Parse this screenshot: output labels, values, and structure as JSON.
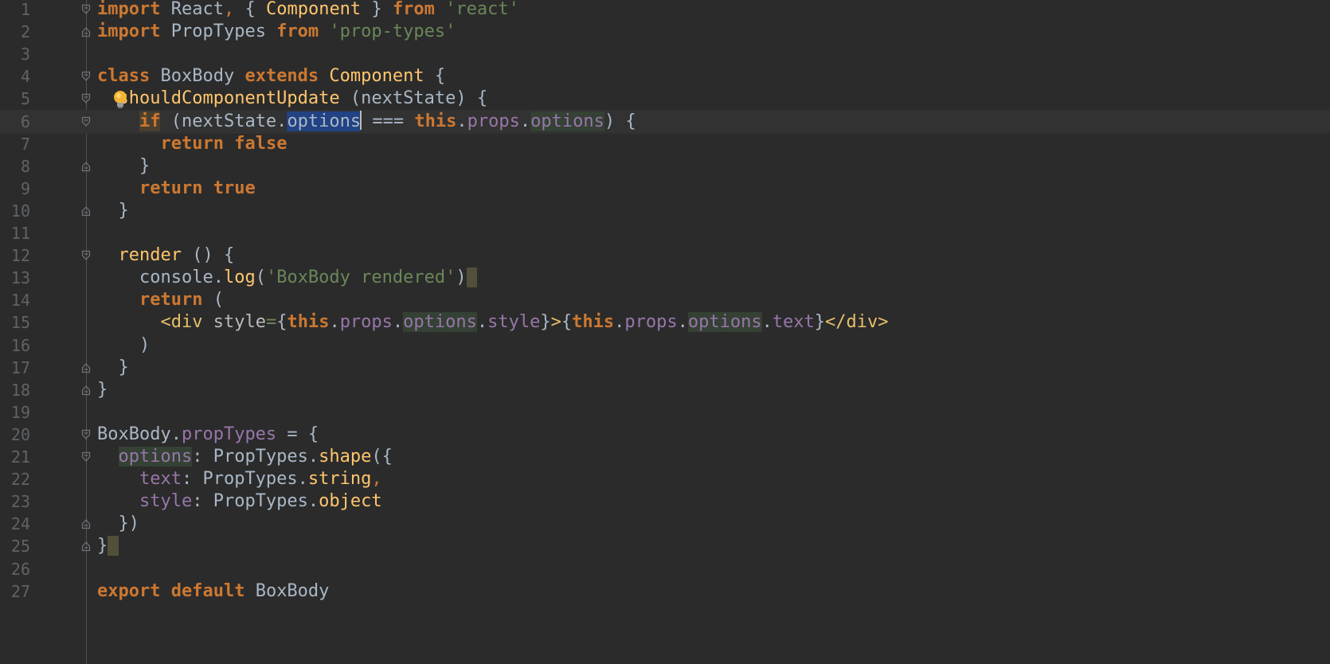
{
  "editor": {
    "language": "javascript",
    "current_line": 6,
    "lines": [
      {
        "n": "1",
        "fold": "open",
        "tokens": [
          {
            "t": "import",
            "k": "keyword"
          },
          {
            "t": " React",
            "k": "plain"
          },
          {
            "t": ",",
            "k": "punct"
          },
          {
            "t": " { ",
            "k": "plain"
          },
          {
            "t": "Component",
            "k": "class"
          },
          {
            "t": " } ",
            "k": "plain"
          },
          {
            "t": "from",
            "k": "keyword"
          },
          {
            "t": " ",
            "k": "plain"
          },
          {
            "t": "'react'",
            "k": "string"
          }
        ]
      },
      {
        "n": "2",
        "fold": "close",
        "tokens": [
          {
            "t": "import",
            "k": "keyword"
          },
          {
            "t": " PropTypes ",
            "k": "plain"
          },
          {
            "t": "from",
            "k": "keyword"
          },
          {
            "t": " ",
            "k": "plain"
          },
          {
            "t": "'prop-types'",
            "k": "string"
          }
        ]
      },
      {
        "n": "3",
        "fold": "",
        "tokens": []
      },
      {
        "n": "4",
        "fold": "open",
        "tokens": [
          {
            "t": "class",
            "k": "keyword"
          },
          {
            "t": " BoxBody ",
            "k": "plain"
          },
          {
            "t": "extends",
            "k": "keyword"
          },
          {
            "t": " ",
            "k": "plain"
          },
          {
            "t": "Component",
            "k": "class"
          },
          {
            "t": " {",
            "k": "plain"
          }
        ]
      },
      {
        "n": "5",
        "fold": "open",
        "bulb": true,
        "tokens": [
          {
            "t": "  ",
            "k": "plain"
          },
          {
            "t": "shouldComponentUpdate",
            "k": "method"
          },
          {
            "t": " (nextState) {",
            "k": "plain"
          }
        ]
      },
      {
        "n": "6",
        "fold": "open",
        "tokens": [
          {
            "t": "    ",
            "k": "plain"
          },
          {
            "t": "if",
            "k": "keyword",
            "hl": "keyword"
          },
          {
            "t": " (nextState.",
            "k": "plain"
          },
          {
            "t": "options",
            "k": "plain",
            "hl": "selection"
          },
          {
            "caret": true
          },
          {
            "t": " === ",
            "k": "plain"
          },
          {
            "t": "this",
            "k": "keyword"
          },
          {
            "t": ".",
            "k": "plain"
          },
          {
            "t": "props",
            "k": "field"
          },
          {
            "t": ".",
            "k": "plain"
          },
          {
            "t": "options",
            "k": "field",
            "hl": "usage"
          },
          {
            "t": ") {",
            "k": "plain"
          }
        ]
      },
      {
        "n": "7",
        "fold": "",
        "tokens": [
          {
            "t": "      ",
            "k": "plain"
          },
          {
            "t": "return",
            "k": "keyword"
          },
          {
            "t": " ",
            "k": "plain"
          },
          {
            "t": "false",
            "k": "keyword"
          }
        ]
      },
      {
        "n": "8",
        "fold": "close",
        "tokens": [
          {
            "t": "    }",
            "k": "plain"
          }
        ]
      },
      {
        "n": "9",
        "fold": "",
        "tokens": [
          {
            "t": "    ",
            "k": "plain"
          },
          {
            "t": "return",
            "k": "keyword"
          },
          {
            "t": " ",
            "k": "plain"
          },
          {
            "t": "true",
            "k": "keyword"
          }
        ]
      },
      {
        "n": "10",
        "fold": "close",
        "tokens": [
          {
            "t": "  }",
            "k": "plain"
          }
        ]
      },
      {
        "n": "11",
        "fold": "",
        "tokens": []
      },
      {
        "n": "12",
        "fold": "open",
        "tokens": [
          {
            "t": "  ",
            "k": "plain"
          },
          {
            "t": "render",
            "k": "method"
          },
          {
            "t": " () {",
            "k": "plain"
          }
        ]
      },
      {
        "n": "13",
        "fold": "",
        "tokens": [
          {
            "t": "    console.",
            "k": "plain"
          },
          {
            "t": "log",
            "k": "function"
          },
          {
            "t": "(",
            "k": "plain"
          },
          {
            "t": "'BoxBody rendered'",
            "k": "string"
          },
          {
            "t": ")",
            "k": "plain"
          },
          {
            "t": " ",
            "k": "plain",
            "hl": "caret-box"
          }
        ]
      },
      {
        "n": "14",
        "fold": "",
        "tokens": [
          {
            "t": "    ",
            "k": "plain"
          },
          {
            "t": "return",
            "k": "keyword"
          },
          {
            "t": " (",
            "k": "plain"
          }
        ]
      },
      {
        "n": "15",
        "fold": "",
        "tokens": [
          {
            "t": "      ",
            "k": "plain"
          },
          {
            "t": "<div",
            "k": "tag"
          },
          {
            "t": " ",
            "k": "plain"
          },
          {
            "t": "style",
            "k": "attr"
          },
          {
            "t": "=",
            "k": "string"
          },
          {
            "t": "{",
            "k": "plain"
          },
          {
            "t": "this",
            "k": "keyword"
          },
          {
            "t": ".",
            "k": "plain"
          },
          {
            "t": "props",
            "k": "field"
          },
          {
            "t": ".",
            "k": "plain"
          },
          {
            "t": "options",
            "k": "field",
            "hl": "usage"
          },
          {
            "t": ".",
            "k": "plain"
          },
          {
            "t": "style",
            "k": "field"
          },
          {
            "t": "}",
            "k": "plain"
          },
          {
            "t": ">",
            "k": "tag"
          },
          {
            "t": "{",
            "k": "plain"
          },
          {
            "t": "this",
            "k": "keyword"
          },
          {
            "t": ".",
            "k": "plain"
          },
          {
            "t": "props",
            "k": "field"
          },
          {
            "t": ".",
            "k": "plain"
          },
          {
            "t": "options",
            "k": "field",
            "hl": "usage"
          },
          {
            "t": ".",
            "k": "plain"
          },
          {
            "t": "text",
            "k": "field"
          },
          {
            "t": "}",
            "k": "plain"
          },
          {
            "t": "</div>",
            "k": "tag"
          }
        ]
      },
      {
        "n": "16",
        "fold": "",
        "tokens": [
          {
            "t": "    )",
            "k": "plain"
          }
        ]
      },
      {
        "n": "17",
        "fold": "close",
        "tokens": [
          {
            "t": "  }",
            "k": "plain"
          }
        ]
      },
      {
        "n": "18",
        "fold": "close",
        "tokens": [
          {
            "t": "}",
            "k": "plain"
          }
        ]
      },
      {
        "n": "19",
        "fold": "",
        "tokens": []
      },
      {
        "n": "20",
        "fold": "open",
        "tokens": [
          {
            "t": "BoxBody.",
            "k": "plain"
          },
          {
            "t": "propTypes",
            "k": "field"
          },
          {
            "t": " = {",
            "k": "plain"
          }
        ]
      },
      {
        "n": "21",
        "fold": "open",
        "tokens": [
          {
            "t": "  ",
            "k": "plain"
          },
          {
            "t": "options",
            "k": "field",
            "hl": "usage"
          },
          {
            "t": ": PropTypes.",
            "k": "plain"
          },
          {
            "t": "shape",
            "k": "function"
          },
          {
            "t": "({",
            "k": "plain"
          }
        ]
      },
      {
        "n": "22",
        "fold": "",
        "tokens": [
          {
            "t": "    ",
            "k": "plain"
          },
          {
            "t": "text",
            "k": "field"
          },
          {
            "t": ": PropTypes.",
            "k": "plain"
          },
          {
            "t": "string",
            "k": "function"
          },
          {
            "t": ",",
            "k": "punct"
          }
        ]
      },
      {
        "n": "23",
        "fold": "",
        "tokens": [
          {
            "t": "    ",
            "k": "plain"
          },
          {
            "t": "style",
            "k": "field"
          },
          {
            "t": ": PropTypes.",
            "k": "plain"
          },
          {
            "t": "object",
            "k": "function"
          }
        ]
      },
      {
        "n": "24",
        "fold": "close",
        "tokens": [
          {
            "t": "  })",
            "k": "plain"
          }
        ]
      },
      {
        "n": "25",
        "fold": "close",
        "tokens": [
          {
            "t": "}",
            "k": "plain"
          },
          {
            "t": " ",
            "k": "plain",
            "hl": "caret-box"
          }
        ]
      },
      {
        "n": "26",
        "fold": "",
        "tokens": []
      },
      {
        "n": "27",
        "fold": "",
        "tokens": [
          {
            "t": "export",
            "k": "keyword"
          },
          {
            "t": " ",
            "k": "plain"
          },
          {
            "t": "default",
            "k": "keyword"
          },
          {
            "t": " BoxBody",
            "k": "plain"
          }
        ]
      }
    ]
  }
}
